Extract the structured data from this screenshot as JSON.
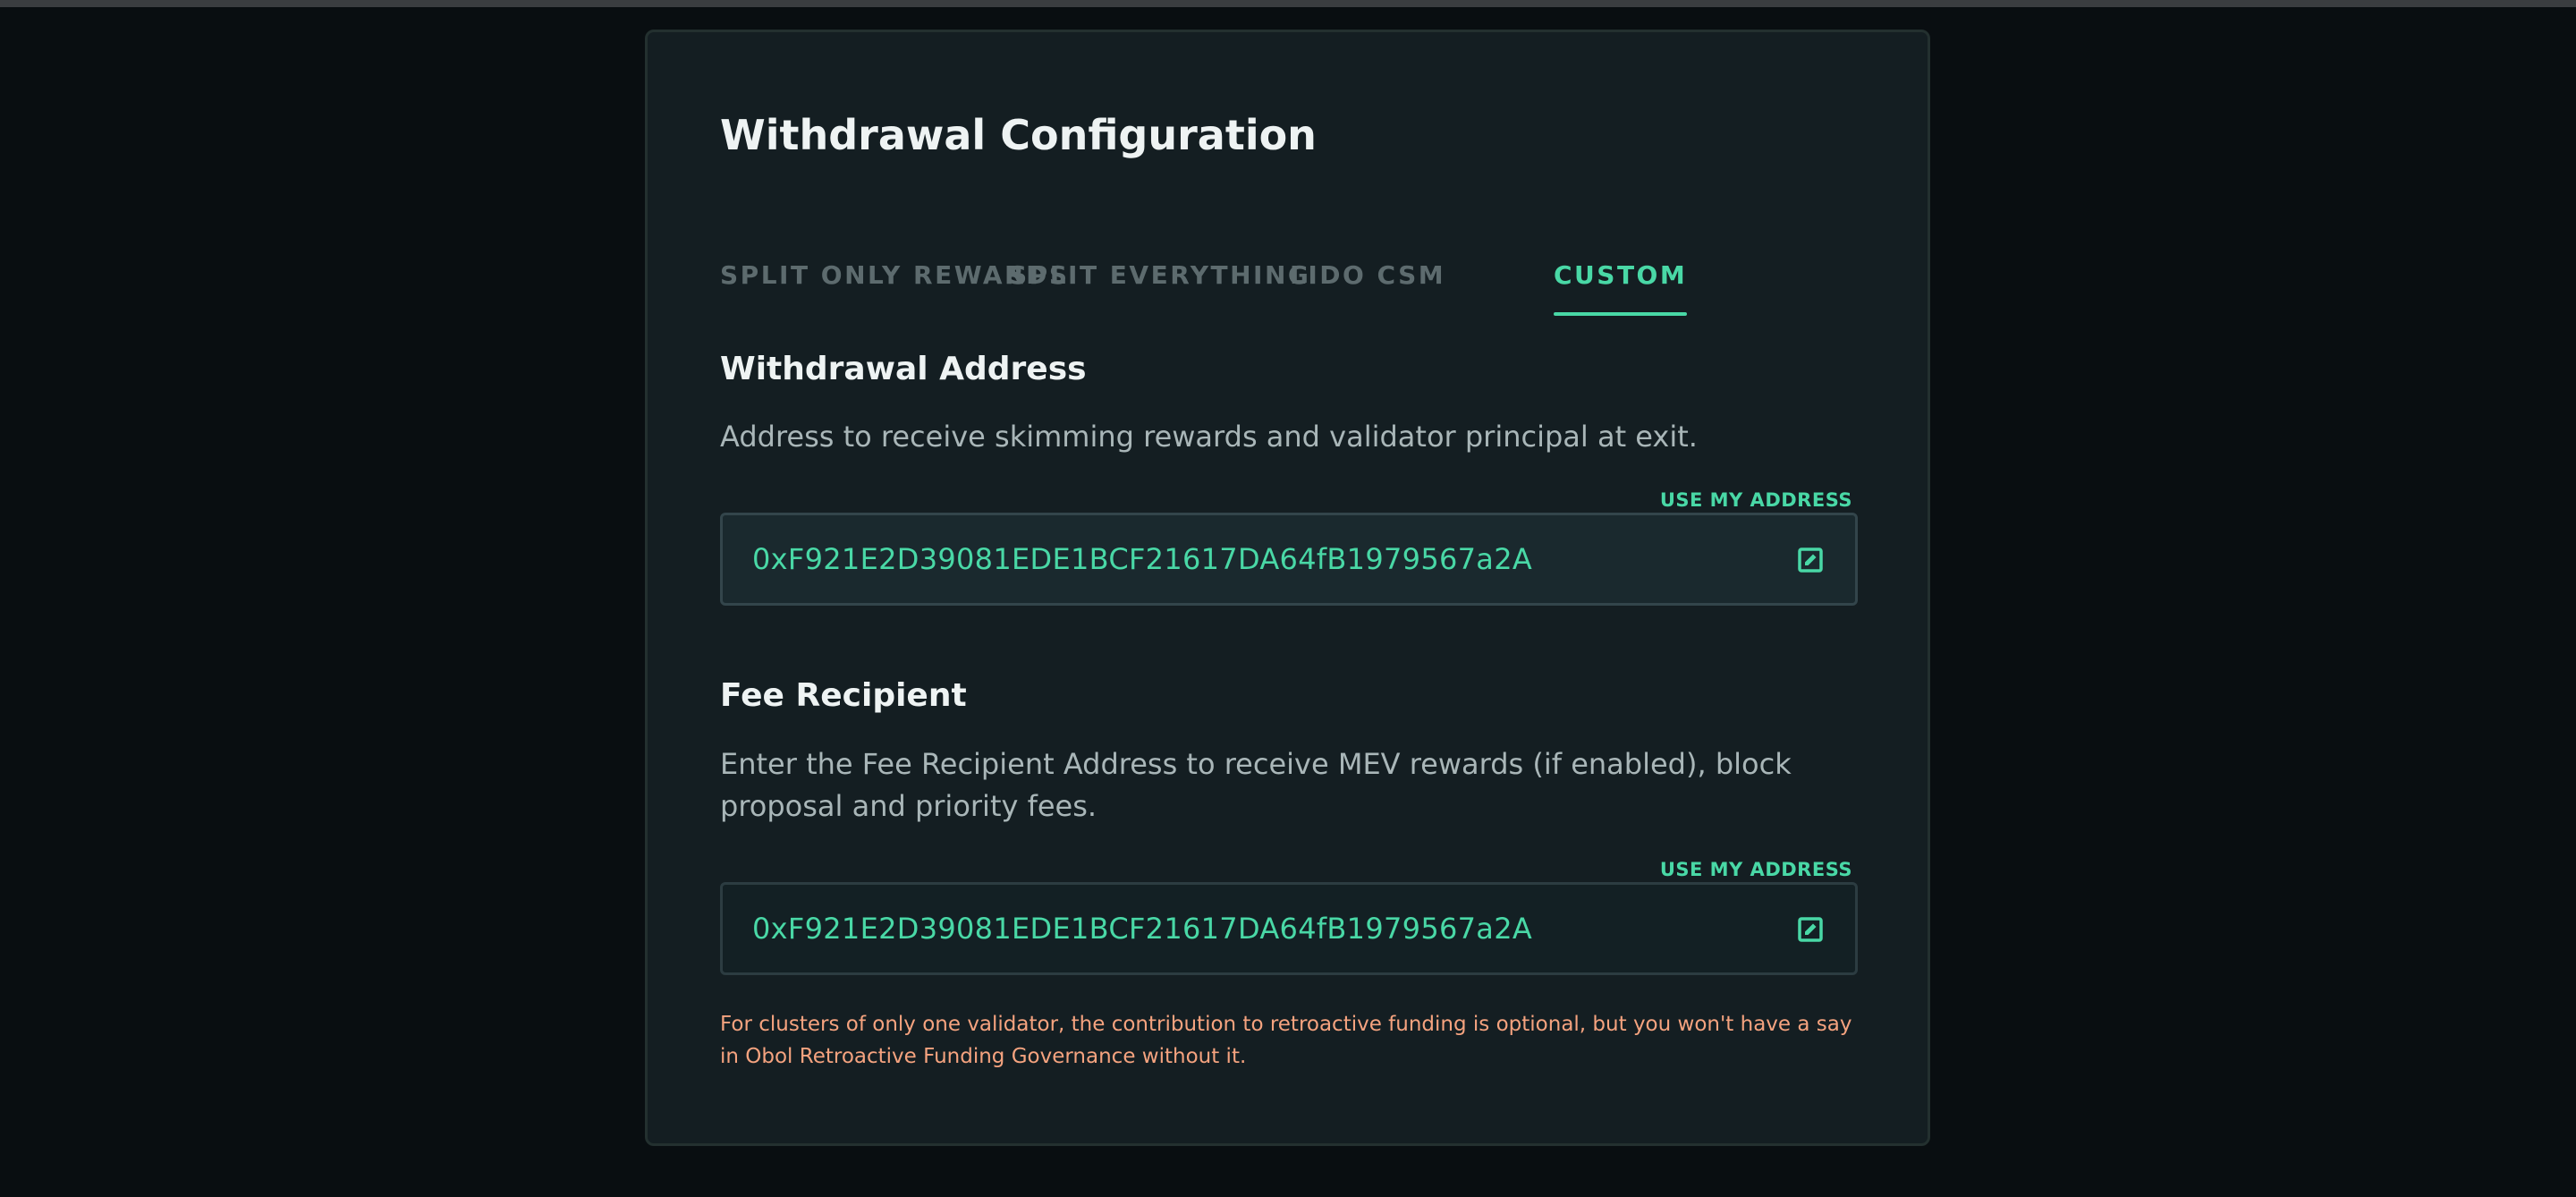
{
  "card": {
    "title": "Withdrawal Configuration"
  },
  "tabs": [
    {
      "label": "SPLIT ONLY REWARDS",
      "active": false
    },
    {
      "label": "SPLIT EVERYTHING",
      "active": false
    },
    {
      "label": "LIDO CSM",
      "active": false
    },
    {
      "label": "CUSTOM",
      "active": true
    }
  ],
  "withdrawal": {
    "title": "Withdrawal Address",
    "description": "Address to receive skimming rewards and validator principal at exit.",
    "use_my_address": "USE MY ADDRESS",
    "value": "0xF921E2D39081EDE1BCF21617DA64fB1979567a2A",
    "icon": "edit-icon"
  },
  "fee_recipient": {
    "title": "Fee Recipient",
    "description": "Enter the Fee Recipient Address to receive MEV rewards (if enabled), block proposal and priority fees.",
    "use_my_address": "USE MY ADDRESS",
    "value": "0xF921E2D39081EDE1BCF21617DA64fB1979567a2A",
    "icon": "edit-icon"
  },
  "note": "For clusters of only one validator, the contribution to retroactive funding is optional, but you won't have a say in Obol Retroactive Funding Governance without it.",
  "colors": {
    "accent": "#49d8a6",
    "warning": "#f5a37f",
    "background": "#090e11",
    "card": "#141e22"
  }
}
